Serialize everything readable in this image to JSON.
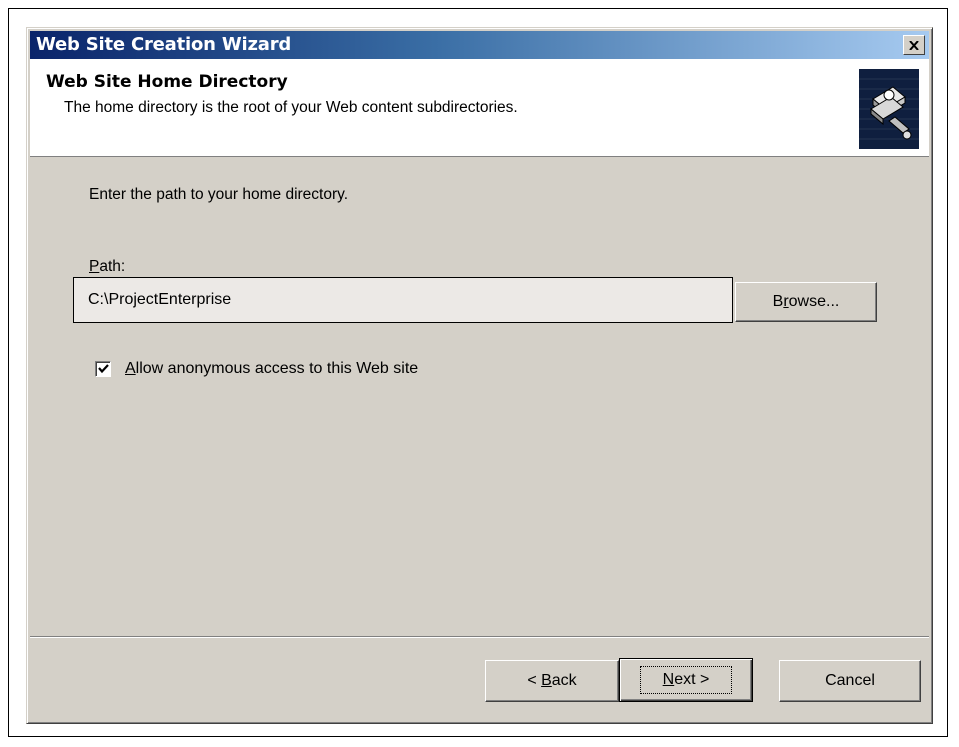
{
  "window": {
    "title": "Web Site Creation Wizard"
  },
  "header": {
    "title": "Web Site Home Directory",
    "subtitle": "The home directory is the root of your Web content subdirectories.",
    "icon": "wizard-book-icon"
  },
  "body": {
    "instruction": "Enter the path to your home directory.",
    "path_label_prefix": "P",
    "path_label_rest": "ath:",
    "path_value": "C:\\ProjectEnterprise",
    "browse_prefix": "B",
    "browse_mnemonic": "r",
    "browse_rest": "owse...",
    "checkbox_checked": true,
    "checkbox_mnemonic": "A",
    "checkbox_rest": "llow anonymous access to this Web site"
  },
  "footer": {
    "back_prefix": "< ",
    "back_mnemonic": "B",
    "back_rest": "ack",
    "next_mnemonic": "N",
    "next_rest": "ext >",
    "cancel_label": "Cancel"
  }
}
